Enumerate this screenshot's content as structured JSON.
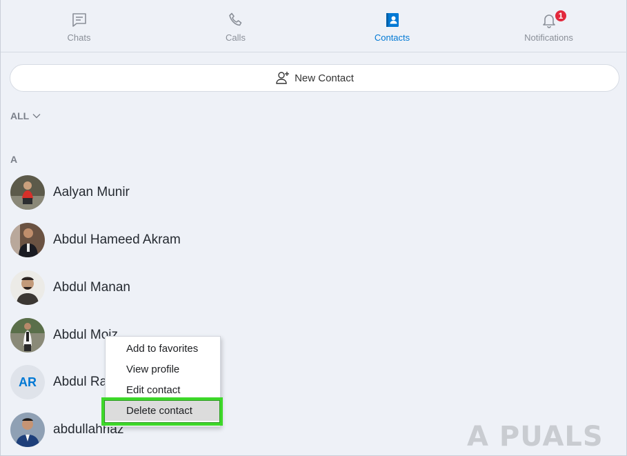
{
  "tabs": [
    {
      "label": "Chats",
      "icon": "chat-icon",
      "active": false
    },
    {
      "label": "Calls",
      "icon": "phone-icon",
      "active": false
    },
    {
      "label": "Contacts",
      "icon": "contacts-book-icon",
      "active": true
    },
    {
      "label": "Notifications",
      "icon": "bell-icon",
      "active": false,
      "badge": "1"
    }
  ],
  "new_contact": {
    "label": "New Contact",
    "icon": "add-person-icon"
  },
  "filter": {
    "label": "ALL",
    "icon": "chevron-down-icon"
  },
  "section": {
    "letter": "A"
  },
  "contacts": [
    {
      "name": "Aalyan Munir",
      "avatar": "photo"
    },
    {
      "name": "Abdul Hameed Akram",
      "avatar": "photo"
    },
    {
      "name": "Abdul Manan",
      "avatar": "photo"
    },
    {
      "name": "Abdul Moiz",
      "avatar": "photo"
    },
    {
      "name": "Abdul Rauf",
      "avatar": "initials",
      "initials": "AR"
    },
    {
      "name": "abdullahriaz",
      "avatar": "photo"
    }
  ],
  "context_menu": {
    "items": [
      {
        "label": "Add to favorites"
      },
      {
        "label": "View profile"
      },
      {
        "label": "Edit contact"
      },
      {
        "label": "Delete contact",
        "highlighted": true
      }
    ]
  },
  "watermark": {
    "text": "A  PUALS"
  },
  "colors": {
    "accent": "#0078d4",
    "badge": "#e2283c",
    "highlight_border": "#3ed82a",
    "background": "#eef1f7"
  }
}
